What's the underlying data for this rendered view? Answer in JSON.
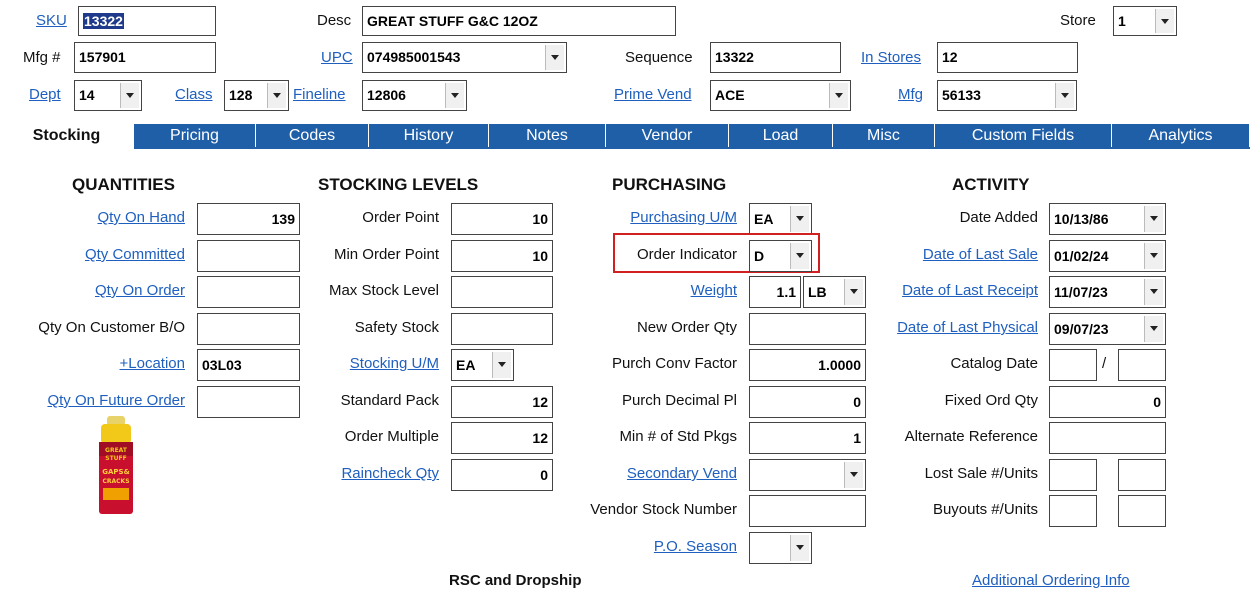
{
  "header": {
    "sku_label": "SKU",
    "sku_value": "13322",
    "desc_label": "Desc",
    "desc_value": "GREAT STUFF G&C 12OZ",
    "store_label": "Store",
    "store_value": "1",
    "mfg_no_label": "Mfg #",
    "mfg_no_value": "157901",
    "upc_label": "UPC",
    "upc_value": "074985001543",
    "sequence_label": "Sequence",
    "sequence_value": "13322",
    "in_stores_label": "In Stores",
    "in_stores_value": "12",
    "dept_label": "Dept",
    "dept_value": "14",
    "class_label": "Class",
    "class_value": "128",
    "fineline_label": "Fineline",
    "fineline_value": "12806",
    "prime_vend_label": "Prime Vend",
    "prime_vend_value": "ACE",
    "mfg_label": "Mfg",
    "mfg_value": "56133"
  },
  "tabs": [
    "Stocking",
    "Pricing",
    "Codes",
    "History",
    "Notes",
    "Vendor",
    "Load",
    "Misc",
    "Custom Fields",
    "Analytics"
  ],
  "quantities": {
    "title": "QUANTITIES",
    "qty_on_hand_label": "Qty On Hand",
    "qty_on_hand": "139",
    "qty_committed_label": "Qty Committed",
    "qty_committed": "",
    "qty_on_order_label": "Qty On Order",
    "qty_on_order": "",
    "qty_customer_bo_label": "Qty On Customer B/O",
    "qty_customer_bo": "",
    "location_label": "+Location",
    "location": "03L03",
    "qty_future_order_label": "Qty On Future Order",
    "qty_future_order": "",
    "product_image_text": "GREAT STUFF GAPS & CRACKS"
  },
  "stocking_levels": {
    "title": "STOCKING LEVELS",
    "order_point_label": "Order Point",
    "order_point": "10",
    "min_order_point_label": "Min Order Point",
    "min_order_point": "10",
    "max_stock_level_label": "Max Stock Level",
    "max_stock_level": "",
    "safety_stock_label": "Safety Stock",
    "safety_stock": "",
    "stocking_um_label": "Stocking U/M",
    "stocking_um": "EA",
    "standard_pack_label": "Standard Pack",
    "standard_pack": "12",
    "order_multiple_label": "Order Multiple",
    "order_multiple": "12",
    "raincheck_qty_label": "Raincheck Qty",
    "raincheck_qty": "0"
  },
  "purchasing": {
    "title": "PURCHASING",
    "purchasing_um_label": "Purchasing U/M",
    "purchasing_um": "EA",
    "order_indicator_label": "Order Indicator",
    "order_indicator": "D",
    "weight_label": "Weight",
    "weight": "1.1",
    "weight_unit": "LB",
    "new_order_qty_label": "New Order Qty",
    "new_order_qty": "",
    "purch_conv_factor_label": "Purch Conv Factor",
    "purch_conv_factor": "1.0000",
    "purch_decimal_pl_label": "Purch Decimal Pl",
    "purch_decimal_pl": "0",
    "min_std_pkgs_label": "Min # of Std Pkgs",
    "min_std_pkgs": "1",
    "secondary_vend_label": "Secondary Vend",
    "secondary_vend": "",
    "vendor_stock_number_label": "Vendor Stock Number",
    "vendor_stock_number": "",
    "po_season_label": "P.O. Season",
    "po_season": ""
  },
  "activity": {
    "title": "ACTIVITY",
    "date_added_label": "Date Added",
    "date_added": "10/13/86",
    "date_last_sale_label": "Date of Last Sale",
    "date_last_sale": "01/02/24",
    "date_last_receipt_label": "Date of Last Receipt",
    "date_last_receipt": "11/07/23",
    "date_last_physical_label": "Date of Last Physical",
    "date_last_physical": "09/07/23",
    "catalog_date_label": "Catalog Date",
    "catalog_date_sep": "/",
    "fixed_ord_qty_label": "Fixed Ord Qty",
    "fixed_ord_qty": "0",
    "alternate_reference_label": "Alternate Reference",
    "alternate_reference": "",
    "lost_sale_label": "Lost Sale #/Units",
    "buyouts_label": "Buyouts #/Units"
  },
  "footer": {
    "rsc_dropship": "RSC and Dropship",
    "additional_ordering_info": "Additional Ordering Info"
  }
}
